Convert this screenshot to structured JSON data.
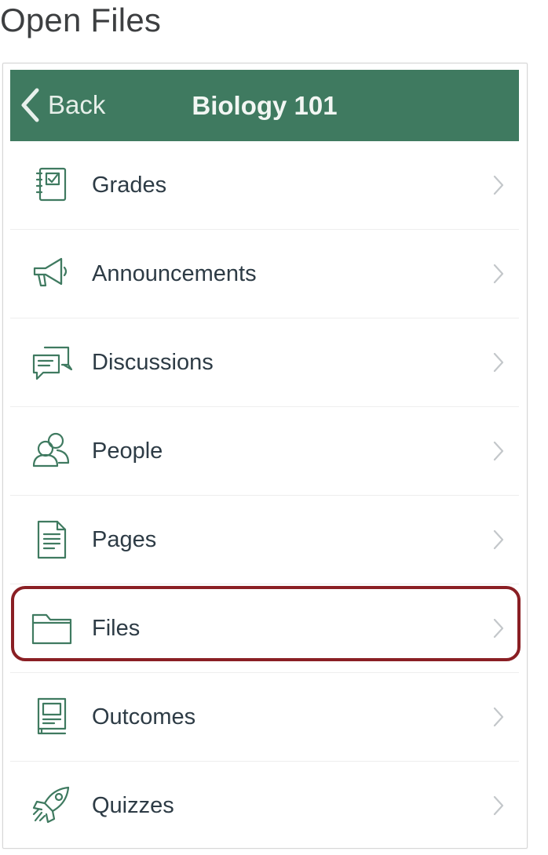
{
  "doc_title": "Open Files",
  "navbar": {
    "back_label": "Back",
    "title": "Biology 101",
    "color": "#3f7a60"
  },
  "menu": {
    "items": [
      {
        "label": "Grades",
        "icon": "gradebook-icon"
      },
      {
        "label": "Announcements",
        "icon": "megaphone-icon"
      },
      {
        "label": "Discussions",
        "icon": "discussion-icon"
      },
      {
        "label": "People",
        "icon": "people-icon"
      },
      {
        "label": "Pages",
        "icon": "document-icon"
      },
      {
        "label": "Files",
        "icon": "folder-icon"
      },
      {
        "label": "Outcomes",
        "icon": "outcomes-icon"
      },
      {
        "label": "Quizzes",
        "icon": "rocket-icon"
      }
    ],
    "highlighted": "Files",
    "highlight_color": "#8a1f24",
    "icon_color": "#3f7a60"
  }
}
